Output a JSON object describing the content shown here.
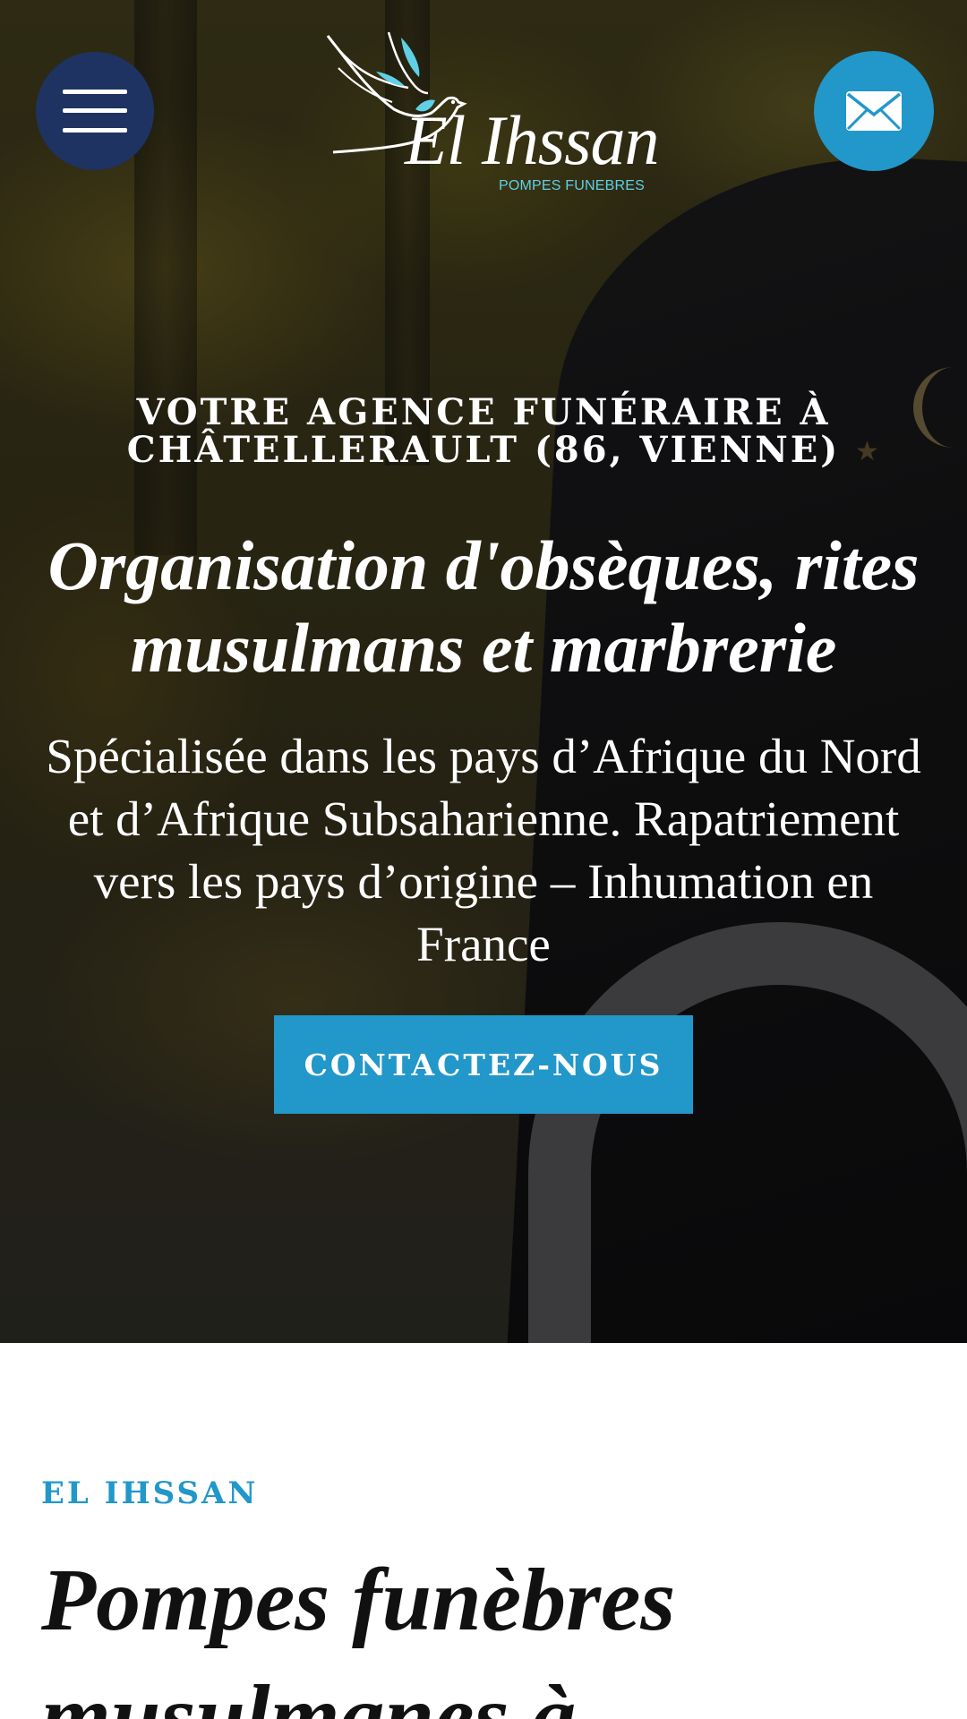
{
  "header": {
    "menu_icon": "hamburger-menu-icon",
    "contact_icon": "envelope-icon",
    "logo": {
      "name": "El Ihssan",
      "subtitle": "POMPES FUNEBRES"
    }
  },
  "hero": {
    "eyebrow": "VOTRE AGENCE FUNÉRAIRE À CHÂTELLERAULT (86, VIENNE)",
    "headline": "Organisation d'obsèques, rites musulmans et marbrerie",
    "description": "Spécialisée dans les pays d’Afrique du Nord et d’Afrique Subsaharienne. Rapatriement vers les pays d’origine – Inhumation en France",
    "cta_label": "CONTACTEZ-NOUS"
  },
  "section": {
    "eyebrow": "EL IHSSAN",
    "title": "Pompes funèbres musulmanes à"
  },
  "colors": {
    "navy": "#1e3362",
    "accent_blue": "#2297c9",
    "logo_cyan": "#5fd0e6",
    "text_dark": "#111111"
  }
}
